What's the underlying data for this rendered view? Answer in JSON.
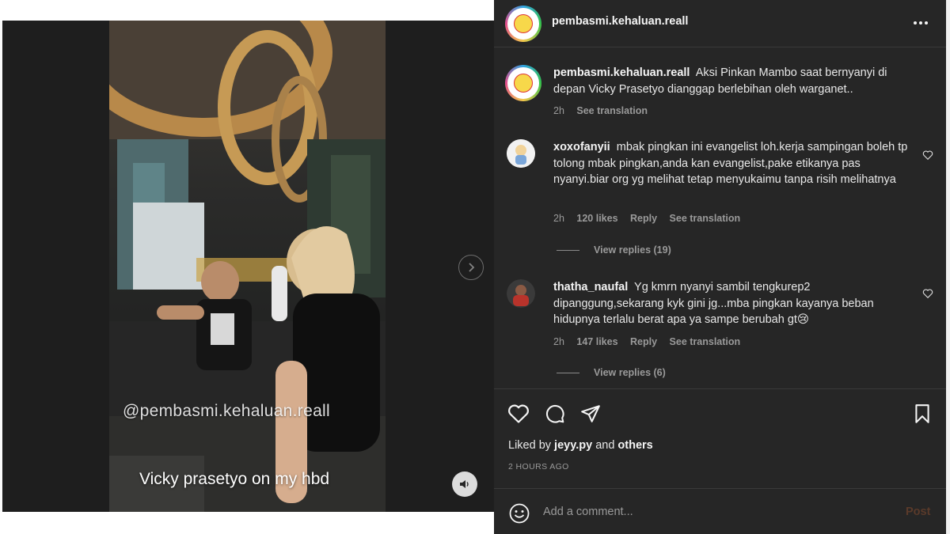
{
  "post": {
    "author": "pembasmi.kehaluan.reall",
    "more_icon": "more-horizontal-icon",
    "caption": "Aksi Pinkan Mambo saat bernyanyi di depan Vicky Prasetyo dianggap berlebihan oleh warganet..",
    "caption_time": "2h",
    "caption_translate": "See translation"
  },
  "media": {
    "watermark": "@pembasmi.kehaluan.reall",
    "caption_overlay": "Vicky prasetyo on my hbd",
    "next_icon": "chevron-right-icon",
    "mute_icon": "speaker-icon"
  },
  "comments": [
    {
      "username": "xoxofanyii",
      "text": "mbak pingkan ini evangelist loh.kerja sampingan boleh tp tolong mbak pingkan,anda kan evangelist,pake etikanya pas nyanyi.biar org yg melihat tetap menyukaimu tanpa risih melihatnya",
      "time": "2h",
      "likes": "120 likes",
      "reply": "Reply",
      "translate": "See translation",
      "view_replies": "View replies (19)"
    },
    {
      "username": "thatha_naufal",
      "text": "Yg kmrn nyanyi sambil tengkurep2 dipanggung,sekarang kyk gini jg...mba pingkan kayanya beban hidupnya terlalu berat apa ya sampe berubah gt😢",
      "time": "2h",
      "likes": "147 likes",
      "reply": "Reply",
      "translate": "See translation",
      "view_replies": "View replies (6)"
    }
  ],
  "actions": {
    "icons": [
      "heart-icon",
      "comment-icon",
      "share-icon",
      "bookmark-icon"
    ],
    "liked_prefix": "Liked by",
    "liked_user": "jeyy.py",
    "liked_and": "and",
    "liked_others": "others",
    "time_ago": "2 HOURS AGO"
  },
  "composer": {
    "placeholder": "Add a comment...",
    "post_label": "Post"
  },
  "colors": {
    "panel_bg": "#262626",
    "media_bg": "#1e1e1e",
    "muted_text": "#9a9a9a",
    "post_button_disabled": "#5a3a2a"
  }
}
